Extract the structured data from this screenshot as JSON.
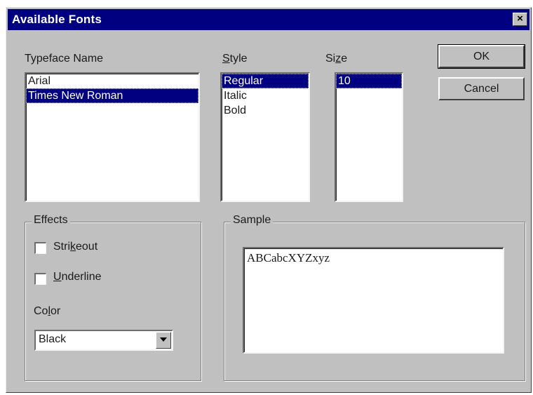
{
  "window": {
    "title": "Available Fonts",
    "close_glyph": "×"
  },
  "typeface": {
    "label": "Typeface Name",
    "items": [
      "Arial",
      "Times New Roman"
    ],
    "selected_index": 1
  },
  "style": {
    "label_mnemonic": "S",
    "label_rest": "tyle",
    "items": [
      "Regular",
      "Italic",
      "Bold"
    ],
    "selected_index": 0
  },
  "size": {
    "label_pre": "Si",
    "label_mnemonic": "z",
    "label_post": "e",
    "items": [
      "10"
    ],
    "selected_index": 0
  },
  "buttons": {
    "ok": "OK",
    "cancel": "Cancel"
  },
  "effects": {
    "title": "Effects",
    "strikeout": {
      "pre": "Stri",
      "mnemonic": "k",
      "post": "eout",
      "checked": false
    },
    "underline": {
      "pre": "",
      "mnemonic": "U",
      "post": "nderline",
      "checked": false
    },
    "color_label_pre": "Co",
    "color_label_mnemonic": "l",
    "color_label_post": "or",
    "color_value": "Black"
  },
  "sample": {
    "title": "Sample",
    "text": "ABCabcXYZxyz"
  },
  "icons": {
    "close": "close-icon",
    "dropdown": "triangle-down-icon",
    "checkbox": "checkbox-icon"
  },
  "colors": {
    "titlebar": "#000080",
    "selection": "#000080",
    "face": "#c0c0c0"
  }
}
